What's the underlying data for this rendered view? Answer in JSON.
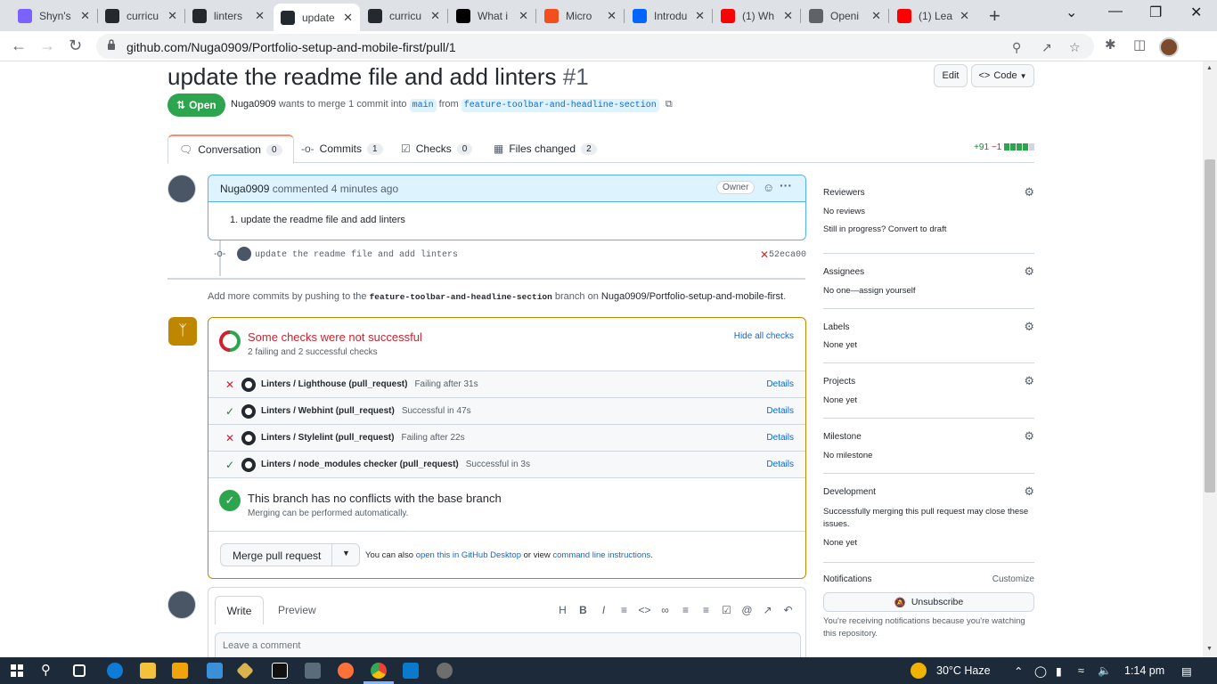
{
  "browser": {
    "tabs": [
      {
        "title": "Shyn's",
        "icon": "mandarin-icon",
        "color": "#7b61ff"
      },
      {
        "title": "curricu",
        "icon": "github-icon",
        "color": "#24292f"
      },
      {
        "title": "linters",
        "icon": "github-icon",
        "color": "#24292f"
      },
      {
        "title": "update",
        "icon": "github-pr-icon",
        "color": "#24292f"
      },
      {
        "title": "curricu",
        "icon": "github-icon",
        "color": "#24292f"
      },
      {
        "title": "What i",
        "icon": "medium-icon",
        "color": "#000000"
      },
      {
        "title": "Micro",
        "icon": "figma-icon",
        "color": "#f24e1e"
      },
      {
        "title": "Introdu",
        "icon": "power-automate-icon",
        "color": "#0066ff"
      },
      {
        "title": "(1) Wh",
        "icon": "youtube-icon",
        "color": "#ff0000"
      },
      {
        "title": "Openi",
        "icon": "code-icon",
        "color": "#5f6368"
      },
      {
        "title": "(1) Lea",
        "icon": "youtube-icon",
        "color": "#ff0000"
      }
    ],
    "url": "github.com/Nuga0909/Portfolio-setup-and-mobile-first/pull/1"
  },
  "pr": {
    "title": "update the readme file and add linters",
    "number": "#1",
    "edit_label": "Edit",
    "code_label": "Code",
    "state": "Open",
    "author": "Nuga0909",
    "merge_text": "wants to merge 1 commit into",
    "base_branch": "main",
    "from_text": "from",
    "head_branch": "feature-toolbar-and-headline-section"
  },
  "pr_tabs": [
    {
      "label": "Conversation",
      "count": "0"
    },
    {
      "label": "Commits",
      "count": "1"
    },
    {
      "label": "Checks",
      "count": "0"
    },
    {
      "label": "Files changed",
      "count": "2"
    }
  ],
  "diffstat": {
    "added": "+91",
    "removed": "−1"
  },
  "comment": {
    "author": "Nuga0909",
    "action": "commented 4 minutes ago",
    "badge": "Owner",
    "body": "1. update the readme file and add linters"
  },
  "commit": {
    "message": "update the readme file and add linters",
    "sha": "52eca00"
  },
  "push_hint": {
    "prefix": "Add more commits by pushing to the",
    "branch": "feature-toolbar-and-headline-section",
    "middle": "branch on",
    "repo": "Nuga0909/Portfolio-setup-and-mobile-first",
    "suffix": "."
  },
  "checks": {
    "title": "Some checks were not successful",
    "subtitle": "2 failing and 2 successful checks",
    "hide_label": "Hide all checks",
    "items": [
      {
        "name": "Linters / Lighthouse (pull_request)",
        "desc": "Failing after 31s",
        "status": "fail",
        "details": "Details"
      },
      {
        "name": "Linters / Webhint (pull_request)",
        "desc": "Successful in 47s",
        "status": "ok",
        "details": "Details"
      },
      {
        "name": "Linters / Stylelint (pull_request)",
        "desc": "Failing after 22s",
        "status": "fail",
        "details": "Details"
      },
      {
        "name": "Linters / node_modules checker (pull_request)",
        "desc": "Successful in 3s",
        "status": "ok",
        "details": "Details"
      }
    ]
  },
  "conflicts": {
    "title": "This branch has no conflicts with the base branch",
    "subtitle": "Merging can be performed automatically."
  },
  "merge": {
    "button": "Merge pull request",
    "also_prefix": "You can also",
    "desktop_link": "open this in GitHub Desktop",
    "or_text": "or view",
    "cli_link": "command line instructions",
    "suffix": "."
  },
  "editor": {
    "write_tab": "Write",
    "preview_tab": "Preview",
    "placeholder": "Leave a comment"
  },
  "sidebar": {
    "reviewers": {
      "label": "Reviewers",
      "value": "No reviews",
      "extra_prefix": "Still in progress?",
      "extra_link": "Convert to draft"
    },
    "assignees": {
      "label": "Assignees",
      "value": "No one—assign yourself"
    },
    "labels": {
      "label": "Labels",
      "value": "None yet"
    },
    "projects": {
      "label": "Projects",
      "value": "None yet"
    },
    "milestone": {
      "label": "Milestone",
      "value": "No milestone"
    },
    "development": {
      "label": "Development",
      "value": "Successfully merging this pull request may close these issues.",
      "value2": "None yet"
    },
    "notifications": {
      "label": "Notifications",
      "customize": "Customize",
      "button": "Unsubscribe",
      "note": "You're receiving notifications because you're watching this repository."
    }
  },
  "taskbar": {
    "weather": "30°C  Haze",
    "time": "1:14 pm"
  }
}
